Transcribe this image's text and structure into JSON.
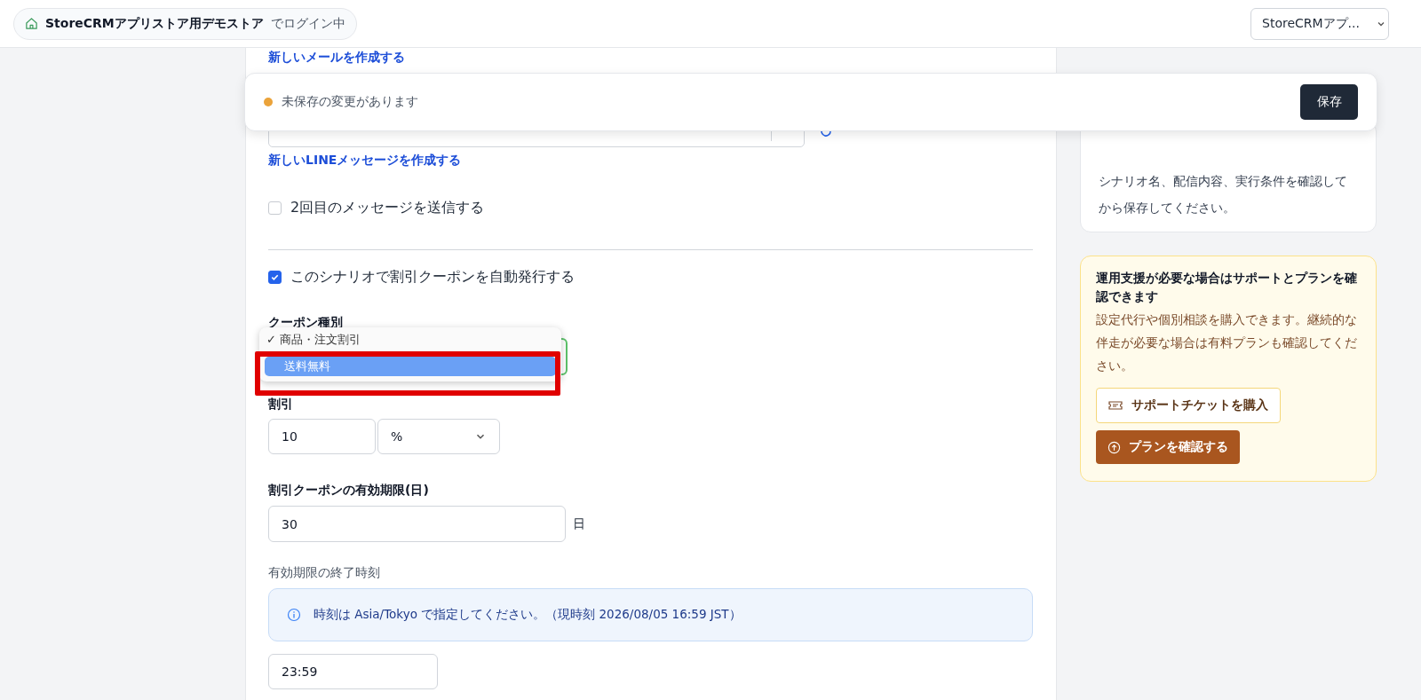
{
  "header": {
    "store_name": "StoreCRMアプリストア用デモストア",
    "login_suffix": "でログイン中",
    "store_select": "StoreCRMアプ..."
  },
  "unsaved_bar": {
    "message": "未保存の変更があります",
    "save_button": "保存"
  },
  "form": {
    "new_mail_link": "新しいメールを作成する",
    "new_line_link": "新しいLINEメッセージを作成する",
    "second_message": {
      "label": "2回目のメッセージを送信する",
      "checked": false
    },
    "auto_coupon": {
      "label": "このシナリオで割引クーポンを自動発行する",
      "checked": true
    },
    "coupon_type": {
      "label": "クーポン種別",
      "options": [
        {
          "label": "✓ 商品・注文割引",
          "selected": false
        },
        {
          "label": "送料無料",
          "selected": true
        }
      ]
    },
    "discount": {
      "label": "割引",
      "value": "10",
      "unit": "%"
    },
    "expiry_days": {
      "label": "割引クーポンの有効期限(日)",
      "value": "30",
      "suffix": "日"
    },
    "end_time": {
      "label": "有効期限の終了時刻",
      "info": "時刻は Asia/Tokyo で指定してください。（現時刻 2026/08/05 16:59 JST）",
      "value": "23:59"
    }
  },
  "sidebar": {
    "confirm_card": {
      "text": "シナリオ名、配信内容、実行条件を確認してから保存してください。"
    },
    "support_card": {
      "title": "運用支援が必要な場合はサポートとプランを確認できます",
      "text": "設定代行や個別相談を購入できます。継続的な伴走が必要な場合は有料プランも確認してください。",
      "ticket_button": "サポートチケットを購入",
      "plan_button": "プランを確認する"
    }
  }
}
